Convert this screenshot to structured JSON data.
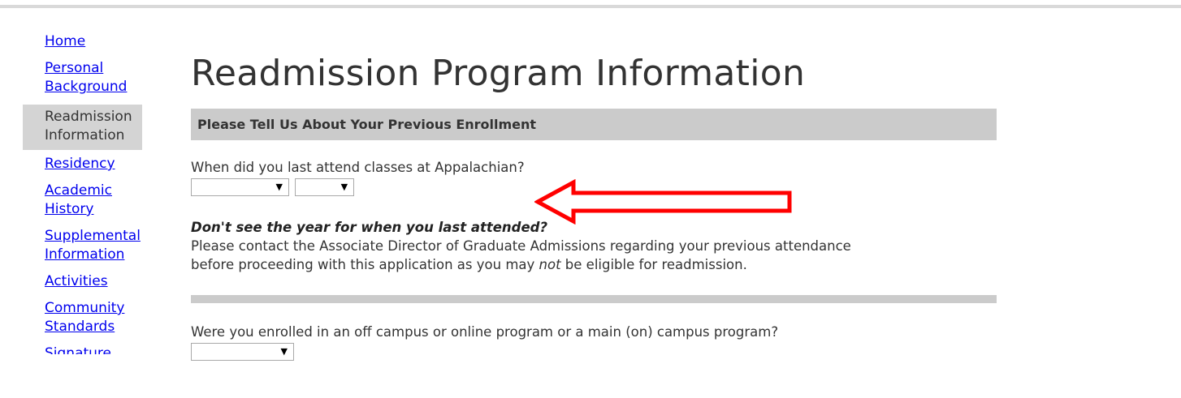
{
  "sidebar": {
    "items": [
      {
        "label": "Home",
        "active": false
      },
      {
        "label": "Personal Background",
        "active": false
      },
      {
        "label": "Readmission Information",
        "active": true
      },
      {
        "label": "Residency",
        "active": false
      },
      {
        "label": "Academic History",
        "active": false
      },
      {
        "label": "Supplemental Information",
        "active": false
      },
      {
        "label": "Activities",
        "active": false
      },
      {
        "label": "Community Standards",
        "active": false
      },
      {
        "label": "Signature",
        "active": false
      }
    ]
  },
  "main": {
    "title": "Readmission Program Information",
    "section_title": "Please Tell Us About Your Previous Enrollment",
    "q1_label": "When did you last attend classes at Appalachian?",
    "q1_term_value": "",
    "q1_year_value": "",
    "note_heading": "Don't see the year for when you last attended?",
    "note_line1": "Please contact the Associate Director of Graduate Admissions regarding your previous attendance",
    "note_line2_a": "before proceeding with this application as you may ",
    "note_line2_em": "not",
    "note_line2_b": " be eligible for readmission.",
    "q2_label": "Were you enrolled in an off campus or online program or a main (on) campus program?",
    "q2_value": ""
  },
  "icons": {
    "dropdown": "caret-down-icon",
    "annotation": "red-arrow-left-icon"
  },
  "colors": {
    "link": "#0000ee",
    "section_bar": "#cbcbcb",
    "active_nav": "#d4d4d4",
    "annotation": "#ff0000"
  }
}
